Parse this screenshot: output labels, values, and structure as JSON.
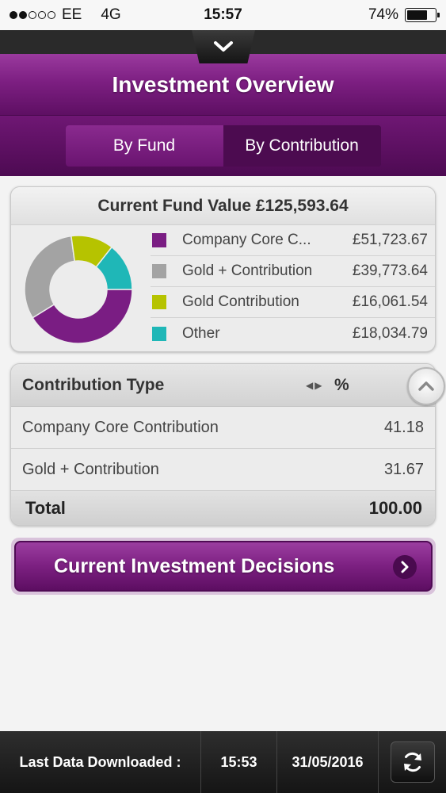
{
  "status": {
    "carrier": "EE",
    "network": "4G",
    "time": "15:57",
    "battery": "74%",
    "battery_level": 0.74,
    "signal_bars": 2
  },
  "header": {
    "title": "Investment Overview"
  },
  "tabs": {
    "by_fund": "By Fund",
    "by_contribution": "By Contribution",
    "active": "by_fund"
  },
  "fund_summary": {
    "title": "Current Fund Value £125,593.64",
    "legend": [
      {
        "name": "Company Core C...",
        "value": "£51,723.67",
        "color": "#7a1d83"
      },
      {
        "name": "Gold + Contribution",
        "value": "£39,773.64",
        "color": "#a3a3a3"
      },
      {
        "name": "Gold Contribution",
        "value": "£16,061.54",
        "color": "#b6c300"
      },
      {
        "name": "Other",
        "value": "£18,034.79",
        "color": "#1fb7b7"
      }
    ]
  },
  "chart_data": {
    "type": "pie",
    "categories": [
      "Company Core C...",
      "Gold + Contribution",
      "Gold Contribution",
      "Other"
    ],
    "values": [
      51723.67,
      39773.64,
      16061.54,
      18034.79
    ],
    "colors": [
      "#7a1d83",
      "#a3a3a3",
      "#b6c300",
      "#1fb7b7"
    ],
    "donut": true
  },
  "contribution": {
    "header": "Contribution Type",
    "pct_header": "%",
    "rows": [
      {
        "type": "Company Core Contribution",
        "pct": "41.18"
      },
      {
        "type": "Gold + Contribution",
        "pct": "31.67"
      }
    ],
    "total_label": "Total",
    "total_value": "100.00"
  },
  "cta": {
    "label": "Current Investment Decisions"
  },
  "footer": {
    "label": "Last Data Downloaded :",
    "time": "15:53",
    "date": "31/05/2016"
  }
}
